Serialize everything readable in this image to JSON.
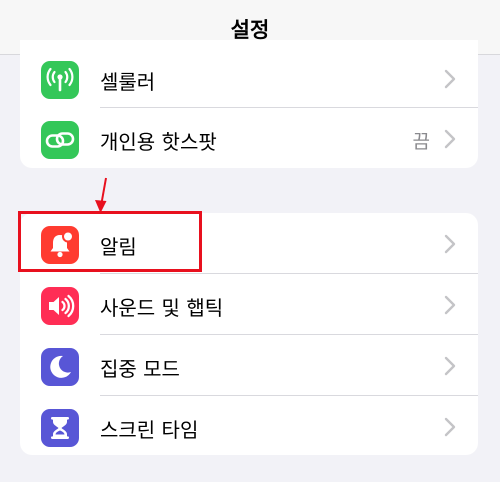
{
  "nav": {
    "title": "설정"
  },
  "group1": {
    "items": [
      {
        "label": "셀룰러",
        "icon": "antenna-icon",
        "color": "#34c759"
      },
      {
        "label": "개인용 핫스팟",
        "value": "끔",
        "icon": "link-chain-icon",
        "color": "#34c759"
      }
    ]
  },
  "group2": {
    "items": [
      {
        "label": "알림",
        "icon": "bell-badge-icon",
        "color": "#ff3b30"
      },
      {
        "label": "사운드 및 햅틱",
        "icon": "speaker-icon",
        "color": "#ff2d55"
      },
      {
        "label": "집중 모드",
        "icon": "moon-icon",
        "color": "#5856d6"
      },
      {
        "label": "스크린 타임",
        "icon": "hourglass-icon",
        "color": "#5856d6"
      }
    ]
  },
  "annotation": {
    "color": "#e8101e",
    "target": "알림"
  }
}
